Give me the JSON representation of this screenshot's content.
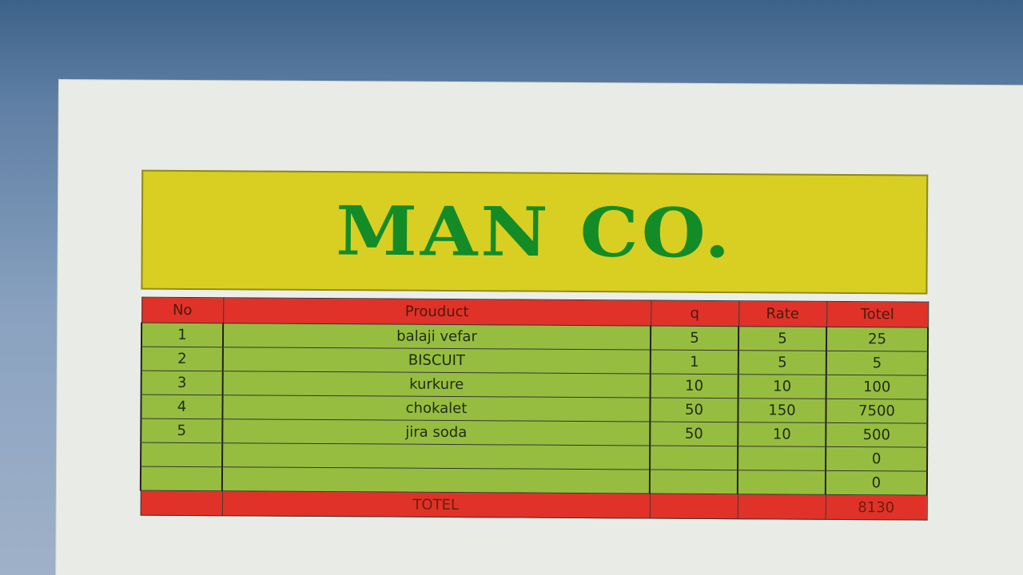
{
  "banner": {
    "title": "MAN CO."
  },
  "table": {
    "headers": {
      "no": "No",
      "product": "Prouduct",
      "q": "q",
      "rate": "Rate",
      "total": "Totel"
    },
    "rows": [
      {
        "no": "1",
        "product": "balaji vefar",
        "q": "5",
        "rate": "5",
        "total": "25"
      },
      {
        "no": "2",
        "product": "BISCUIT",
        "q": "1",
        "rate": "5",
        "total": "5"
      },
      {
        "no": "3",
        "product": "kurkure",
        "q": "10",
        "rate": "10",
        "total": "100"
      },
      {
        "no": "4",
        "product": "chokalet",
        "q": "50",
        "rate": "150",
        "total": "7500"
      },
      {
        "no": "5",
        "product": "jira soda",
        "q": "50",
        "rate": "10",
        "total": "500"
      },
      {
        "no": "",
        "product": "",
        "q": "",
        "rate": "",
        "total": "0"
      },
      {
        "no": "",
        "product": "",
        "q": "",
        "rate": "",
        "total": "0"
      }
    ],
    "footer": {
      "label": "TOTEL",
      "total": "8130"
    }
  },
  "colors": {
    "banner_bg": "#d8cf22",
    "title_text": "#138c27",
    "header_bg": "#e03228",
    "row_bg": "#96bd3f"
  }
}
